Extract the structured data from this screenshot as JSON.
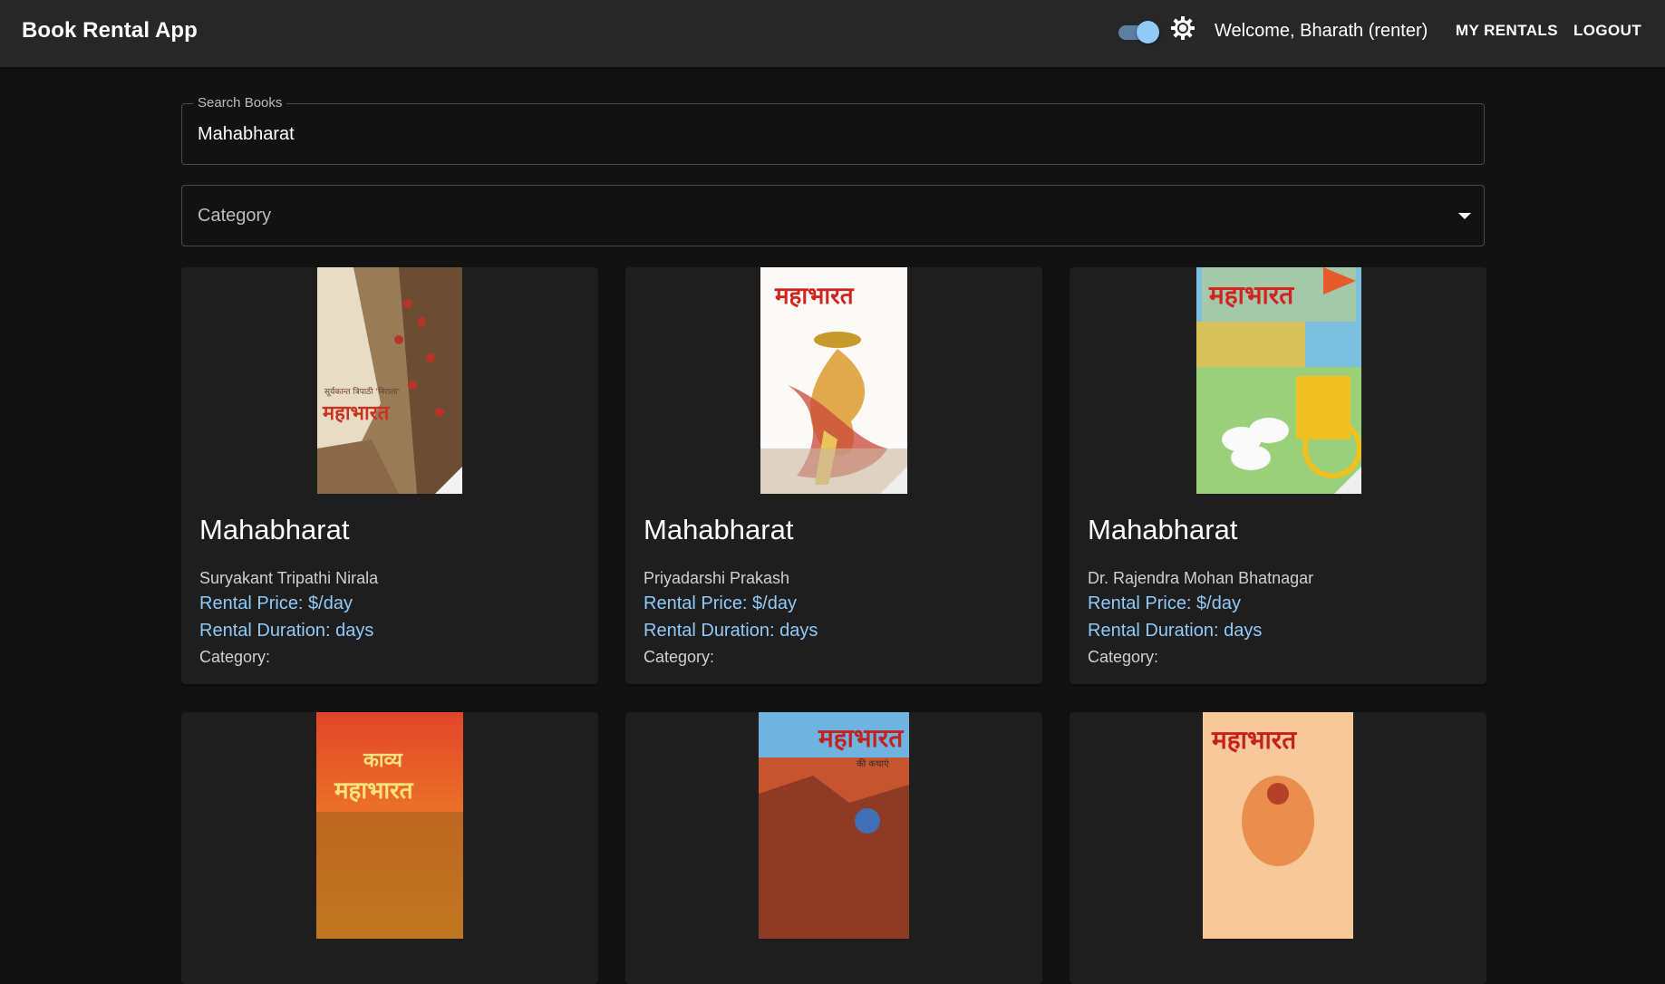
{
  "appbar": {
    "title": "Book Rental App",
    "welcome": "Welcome, Bharath (renter)",
    "my_rentals": "MY RENTALS",
    "logout": "LOGOUT",
    "theme_toggle_on": true,
    "accent": "#90caf9"
  },
  "search": {
    "label": "Search Books",
    "value": "Mahabharat"
  },
  "category_filter": {
    "label": "Category"
  },
  "books": [
    {
      "cover_text": "महाभारत",
      "cover_subtext": "सूर्यकान्त त्रिपाठी 'निराला'",
      "title": "Mahabharat",
      "author": "Suryakant Tripathi Nirala",
      "price": "Rental Price: $/day",
      "duration": "Rental Duration: days",
      "category": "Category:"
    },
    {
      "cover_text": "महाभारत",
      "title": "Mahabharat",
      "author": "Priyadarshi Prakash",
      "price": "Rental Price: $/day",
      "duration": "Rental Duration: days",
      "category": "Category:"
    },
    {
      "cover_text": "महाभारत",
      "title": "Mahabharat",
      "author": "Dr. Rajendra Mohan Bhatnagar",
      "price": "Rental Price: $/day",
      "duration": "Rental Duration: days",
      "category": "Category:"
    },
    {
      "cover_text": "महाभारत",
      "cover_subtext": "काव्य"
    },
    {
      "cover_text": "महाभारत",
      "cover_subtext": "की कथाएं"
    },
    {
      "cover_text": "महाभारत"
    }
  ]
}
